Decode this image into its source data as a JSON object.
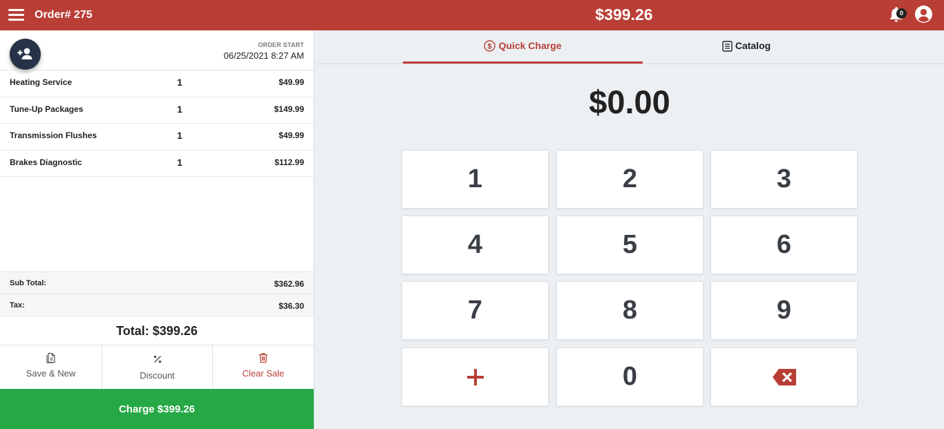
{
  "header": {
    "order_title": "Order# 275",
    "total": "$399.26",
    "notification_count": "0",
    "brand_color": "#b93e36"
  },
  "order": {
    "start_label": "ORDER START",
    "start_value": "06/25/2021 8:27 AM",
    "items": [
      {
        "name": "Heating Service",
        "qty": "1",
        "price": "$49.99"
      },
      {
        "name": "Tune-Up Packages",
        "qty": "1",
        "price": "$149.99"
      },
      {
        "name": "Transmission Flushes",
        "qty": "1",
        "price": "$49.99"
      },
      {
        "name": "Brakes Diagnostic",
        "qty": "1",
        "price": "$112.99"
      }
    ],
    "subtotal_label": "Sub Total:",
    "subtotal_value": "$362.96",
    "tax_label": "Tax:",
    "tax_value": "$36.30",
    "total_text": "Total: $399.26"
  },
  "actions": {
    "save_new": "Save & New",
    "discount": "Discount",
    "clear_sale": "Clear Sale"
  },
  "charge": {
    "label": "Charge $399.26",
    "color": "#27a846"
  },
  "tabs": {
    "quick_charge": "Quick Charge",
    "catalog": "Catalog"
  },
  "keypad": {
    "amount": "$0.00",
    "keys": [
      "1",
      "2",
      "3",
      "4",
      "5",
      "6",
      "7",
      "8",
      "9",
      "0"
    ],
    "plus_icon": "plus-icon",
    "backspace_icon": "backspace-icon"
  }
}
